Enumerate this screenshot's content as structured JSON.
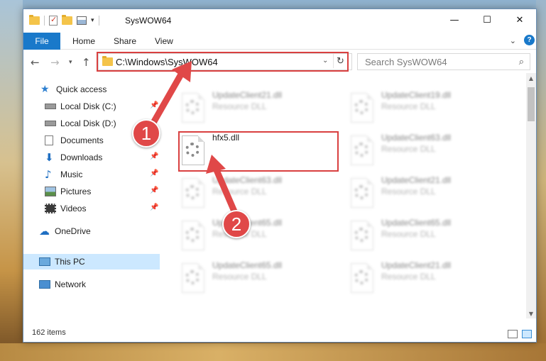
{
  "window": {
    "title": "SysWOW64",
    "minimize_glyph": "—",
    "maximize_glyph": "☐",
    "close_glyph": "✕"
  },
  "ribbon": {
    "tabs": [
      "File",
      "Home",
      "Share",
      "View"
    ]
  },
  "navigation": {
    "address": "C:\\Windows\\SysWOW64",
    "search_placeholder": "Search SysWOW64"
  },
  "sidebar": {
    "items": [
      {
        "label": "Quick access",
        "icon": "star-icon"
      },
      {
        "label": "Local Disk (C:)",
        "icon": "drive-icon"
      },
      {
        "label": "Local Disk (D:)",
        "icon": "drive-icon"
      },
      {
        "label": "Documents",
        "icon": "documents-icon"
      },
      {
        "label": "Downloads",
        "icon": "download-icon"
      },
      {
        "label": "Music",
        "icon": "music-icon"
      },
      {
        "label": "Pictures",
        "icon": "pictures-icon"
      },
      {
        "label": "Videos",
        "icon": "videos-icon"
      },
      {
        "label": "OneDrive",
        "icon": "cloud-icon"
      },
      {
        "label": "This PC",
        "icon": "computer-icon"
      },
      {
        "label": "Network",
        "icon": "network-icon"
      }
    ]
  },
  "files": [
    {
      "name": "UpdateClient21.dll",
      "type": "Resource DLL"
    },
    {
      "name": "UpdateClient19.dll",
      "type": "Resource DLL"
    },
    {
      "name": "hfx5.dll",
      "type": ""
    },
    {
      "name": "UpdateClient63.dll",
      "type": "Resource DLL"
    },
    {
      "name": "UpdateClient63.dll",
      "type": "Resource DLL"
    },
    {
      "name": "UpdateClient21.dll",
      "type": "Resource DLL"
    },
    {
      "name": "UpdateClient65.dll",
      "type": "Resource DLL"
    },
    {
      "name": "UpdateClient65.dll",
      "type": "Resource DLL"
    },
    {
      "name": "UpdateClient65.dll",
      "type": "Resource DLL"
    },
    {
      "name": "UpdateClient21.dll",
      "type": "Resource DLL"
    }
  ],
  "status": {
    "items_count": "162 items"
  },
  "annotations": {
    "callout_1": "1",
    "callout_2": "2",
    "color": "#e04848"
  }
}
